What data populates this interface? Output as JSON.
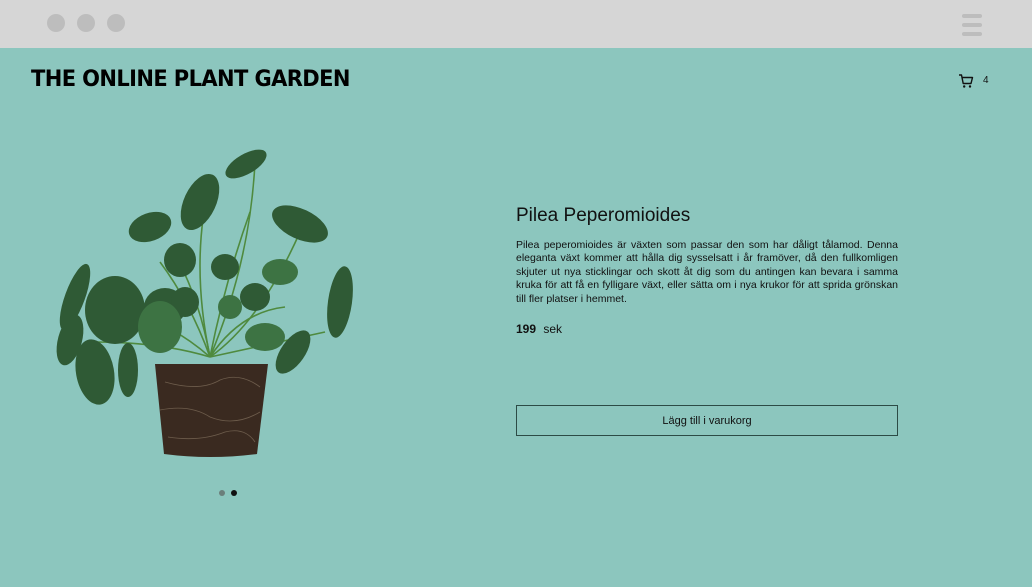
{
  "browser": {
    "window_dots": [
      "close",
      "minimize",
      "maximize"
    ],
    "menu_icon": "hamburger-icon"
  },
  "header": {
    "logo": "THE ONLINE PLANT GARDEN",
    "cart_icon": "cart-icon",
    "cart_count": "4"
  },
  "product": {
    "name": "Pilea Peperomioides",
    "description": "Pilea peperomioides är växten som passar den som har dåligt tålamod. Denna eleganta växt kommer att hålla dig sysselsatt i år framöver, då den fullkomligen skjuter ut nya sticklingar och skott åt dig som du antingen kan bevara i samma kruka för att få en fylligare växt, eller sätta om i nya krukor för att sprida grönskan till fler platser i hemmet.",
    "price": "199",
    "currency": "sek",
    "add_button": "Lägg till i varukorg"
  },
  "carousel": {
    "slide_count": 2,
    "active_index": 1
  },
  "colors": {
    "background": "#8cc6be",
    "chrome": "#d6d6d6",
    "leaf": "#2f5a35",
    "soil": "#3a2a20"
  }
}
